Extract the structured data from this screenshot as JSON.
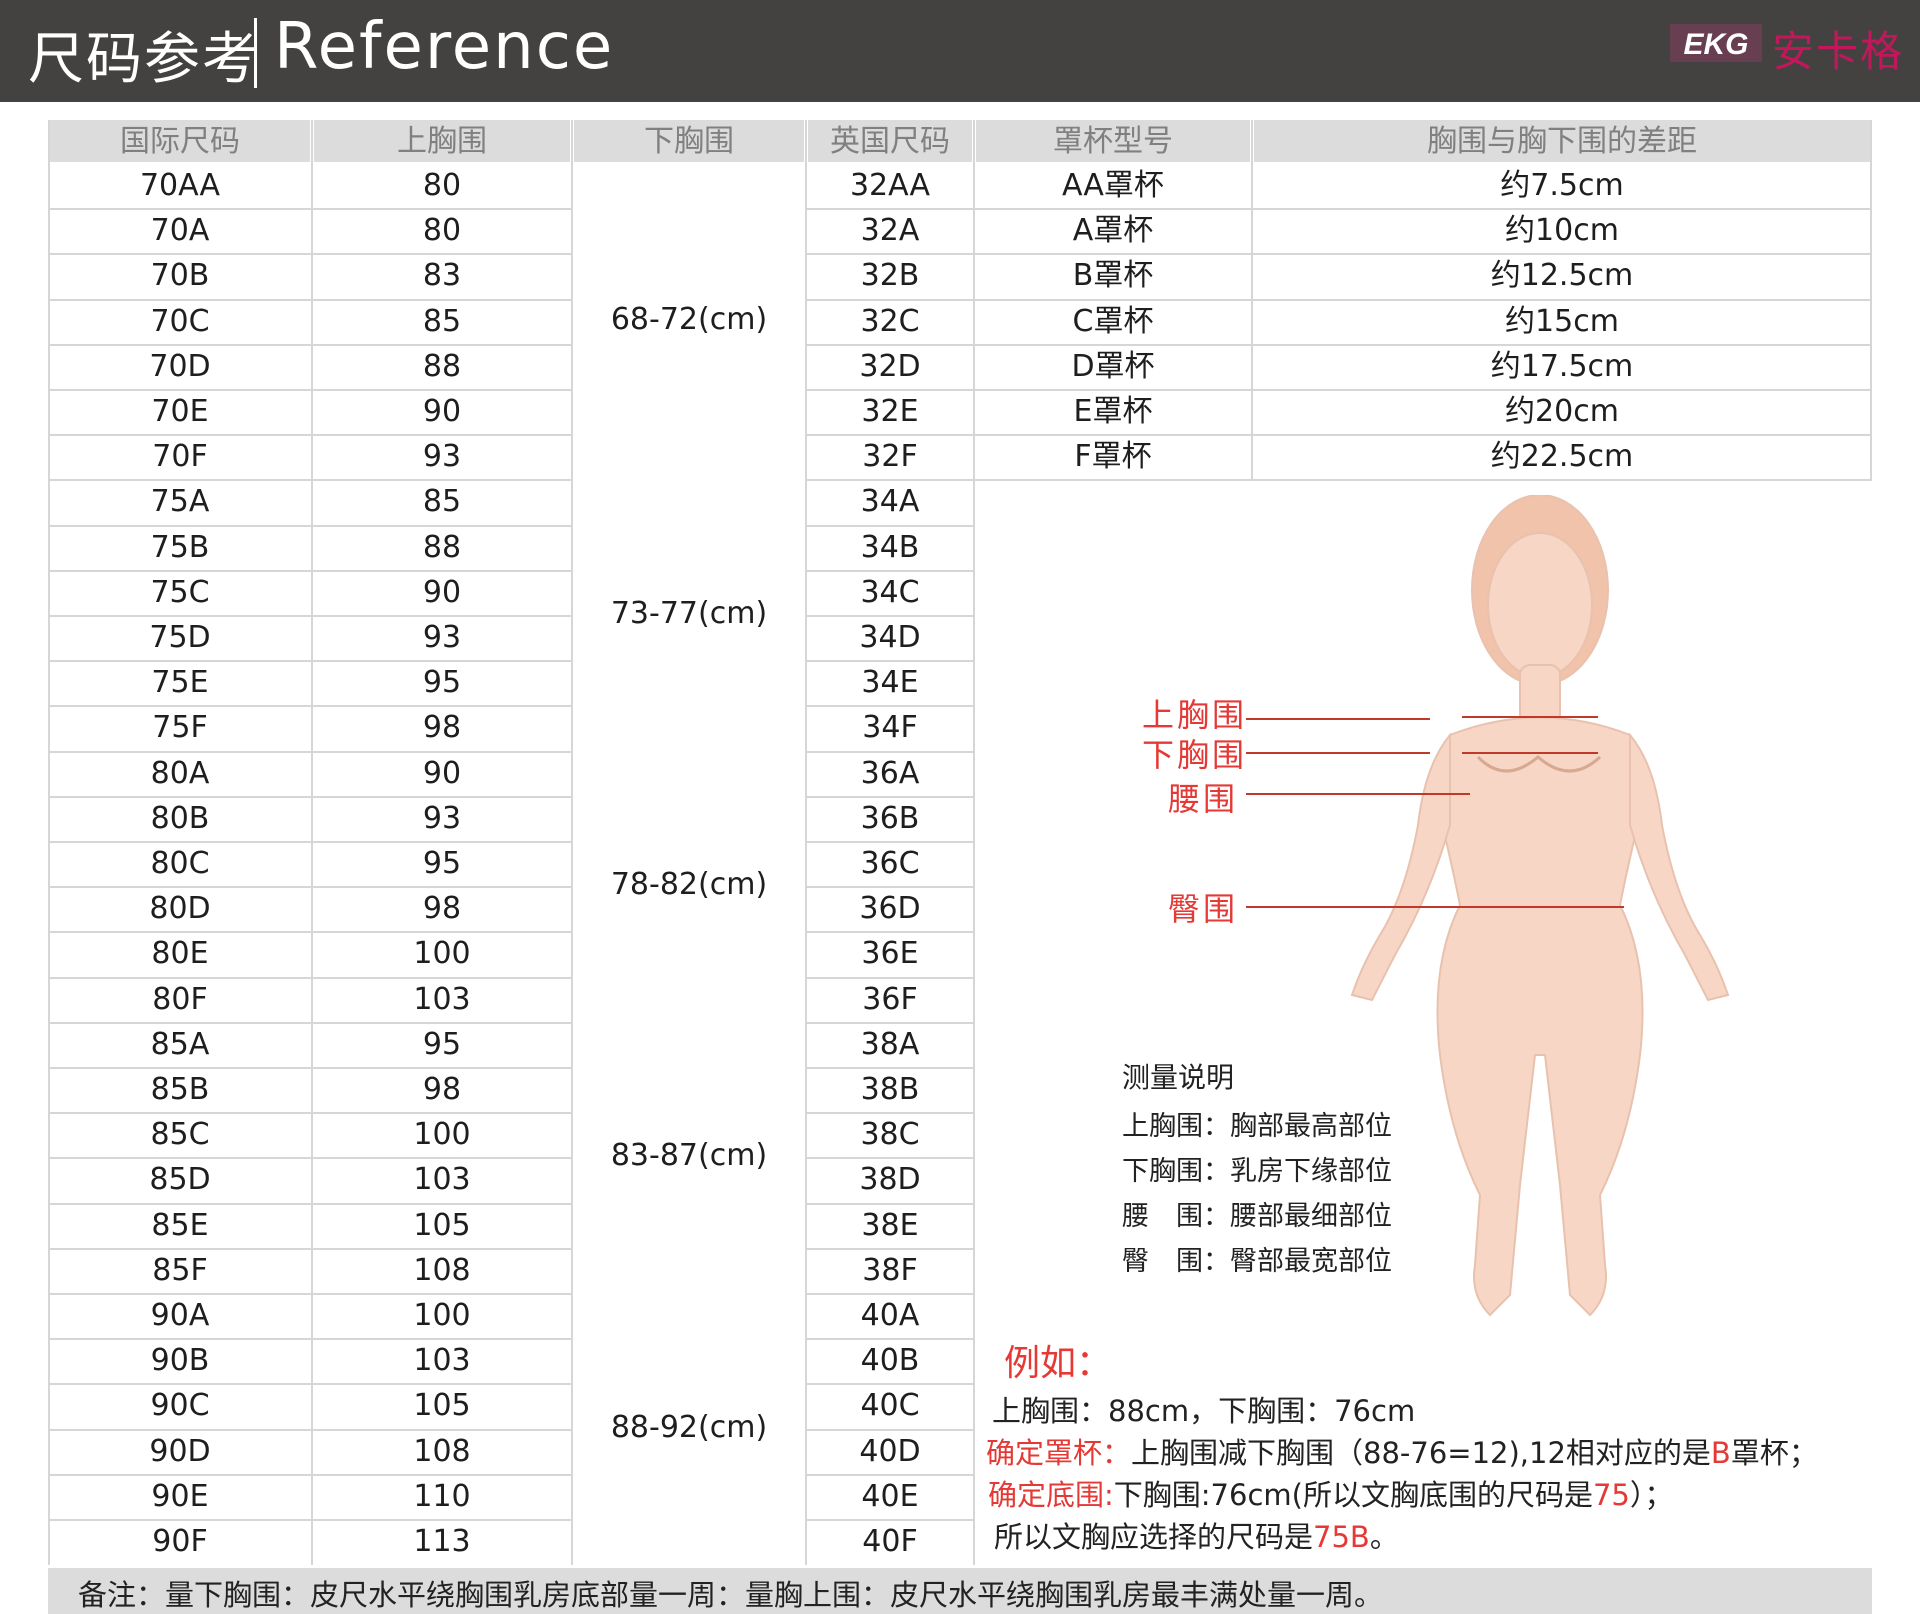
{
  "header": {
    "title_cn": "尺码参考",
    "title_en": "Reference",
    "brand_logo": "EKG",
    "brand_name": "安卡格"
  },
  "table": {
    "headers": [
      "国际尺码",
      "上胸围",
      "下胸围",
      "英国尺码",
      "罩杯型号",
      "胸围与胸下围的差距"
    ],
    "rows": [
      {
        "intl": "70AA",
        "upper": "80",
        "uk": "32AA",
        "cup": "AA罩杯",
        "diff": "约7.5cm"
      },
      {
        "intl": "70A",
        "upper": "80",
        "uk": "32A",
        "cup": "A罩杯",
        "diff": "约10cm"
      },
      {
        "intl": "70B",
        "upper": "83",
        "uk": "32B",
        "cup": "B罩杯",
        "diff": "约12.5cm"
      },
      {
        "intl": "70C",
        "upper": "85",
        "uk": "32C",
        "cup": "C罩杯",
        "diff": "约15cm"
      },
      {
        "intl": "70D",
        "upper": "88",
        "uk": "32D",
        "cup": "D罩杯",
        "diff": "约17.5cm"
      },
      {
        "intl": "70E",
        "upper": "90",
        "uk": "32E",
        "cup": "E罩杯",
        "diff": "约20cm"
      },
      {
        "intl": "70F",
        "upper": "93",
        "uk": "32F",
        "cup": "F罩杯",
        "diff": "约22.5cm"
      },
      {
        "intl": "75A",
        "upper": "85",
        "uk": "34A"
      },
      {
        "intl": "75B",
        "upper": "88",
        "uk": "34B"
      },
      {
        "intl": "75C",
        "upper": "90",
        "uk": "34C"
      },
      {
        "intl": "75D",
        "upper": "93",
        "uk": "34D"
      },
      {
        "intl": "75E",
        "upper": "95",
        "uk": "34E"
      },
      {
        "intl": "75F",
        "upper": "98",
        "uk": "34F"
      },
      {
        "intl": "80A",
        "upper": "90",
        "uk": "36A"
      },
      {
        "intl": "80B",
        "upper": "93",
        "uk": "36B"
      },
      {
        "intl": "80C",
        "upper": "95",
        "uk": "36C"
      },
      {
        "intl": "80D",
        "upper": "98",
        "uk": "36D"
      },
      {
        "intl": "80E",
        "upper": "100",
        "uk": "36E"
      },
      {
        "intl": "80F",
        "upper": "103",
        "uk": "36F"
      },
      {
        "intl": "85A",
        "upper": "95",
        "uk": "38A"
      },
      {
        "intl": "85B",
        "upper": "98",
        "uk": "38B"
      },
      {
        "intl": "85C",
        "upper": "100",
        "uk": "38C"
      },
      {
        "intl": "85D",
        "upper": "103",
        "uk": "38D"
      },
      {
        "intl": "85E",
        "upper": "105",
        "uk": "38E"
      },
      {
        "intl": "85F",
        "upper": "108",
        "uk": "38F"
      },
      {
        "intl": "90A",
        "upper": "100",
        "uk": "40A"
      },
      {
        "intl": "90B",
        "upper": "103",
        "uk": "40B"
      },
      {
        "intl": "90C",
        "upper": "105",
        "uk": "40C"
      },
      {
        "intl": "90D",
        "upper": "108",
        "uk": "40D"
      },
      {
        "intl": "90E",
        "upper": "110",
        "uk": "40E"
      },
      {
        "intl": "90F",
        "upper": "113",
        "uk": "40F"
      }
    ],
    "under_bands": [
      "68-72(cm)",
      "73-77(cm)",
      "78-82(cm)",
      "83-87(cm)",
      "88-92(cm)"
    ]
  },
  "figure": {
    "labels": {
      "bust": "上胸围",
      "underbust": "下胸围",
      "waist": "腰围",
      "hip": "臀围"
    }
  },
  "measurement": {
    "title": "测量说明",
    "notes": [
      "上胸围：胸部最高部位",
      "下胸围：乳房下缘部位",
      "腰　围：腰部最细部位",
      "臀　围：臀部最宽部位"
    ]
  },
  "example": {
    "title": "例如：",
    "line1": "上胸围：88cm，下胸围：76cm",
    "line2_label": "确定罩杯：",
    "line2_text": "上胸围减下胸围（88-76=12),12相对应的是",
    "line2_hl": "B",
    "line2_end": "罩杯；",
    "line3_label": "确定底围:",
    "line3_text": "下胸围:76cm(所以文胸底围的尺码是",
    "line3_hl": "75",
    "line3_end": "）；",
    "line4_text": "所以文胸应选择的尺码是",
    "line4_hl": "75B",
    "line4_end": "。"
  },
  "footer": {
    "note": "备注：量下胸围：皮尺水平绕胸围乳房底部量一周：量胸上围：皮尺水平绕胸围乳房最丰满处量一周。"
  },
  "colors": {
    "header_bg": "#434240",
    "accent": "#e53935",
    "brand": "#c2185b",
    "skin": "#f7d6c6"
  }
}
